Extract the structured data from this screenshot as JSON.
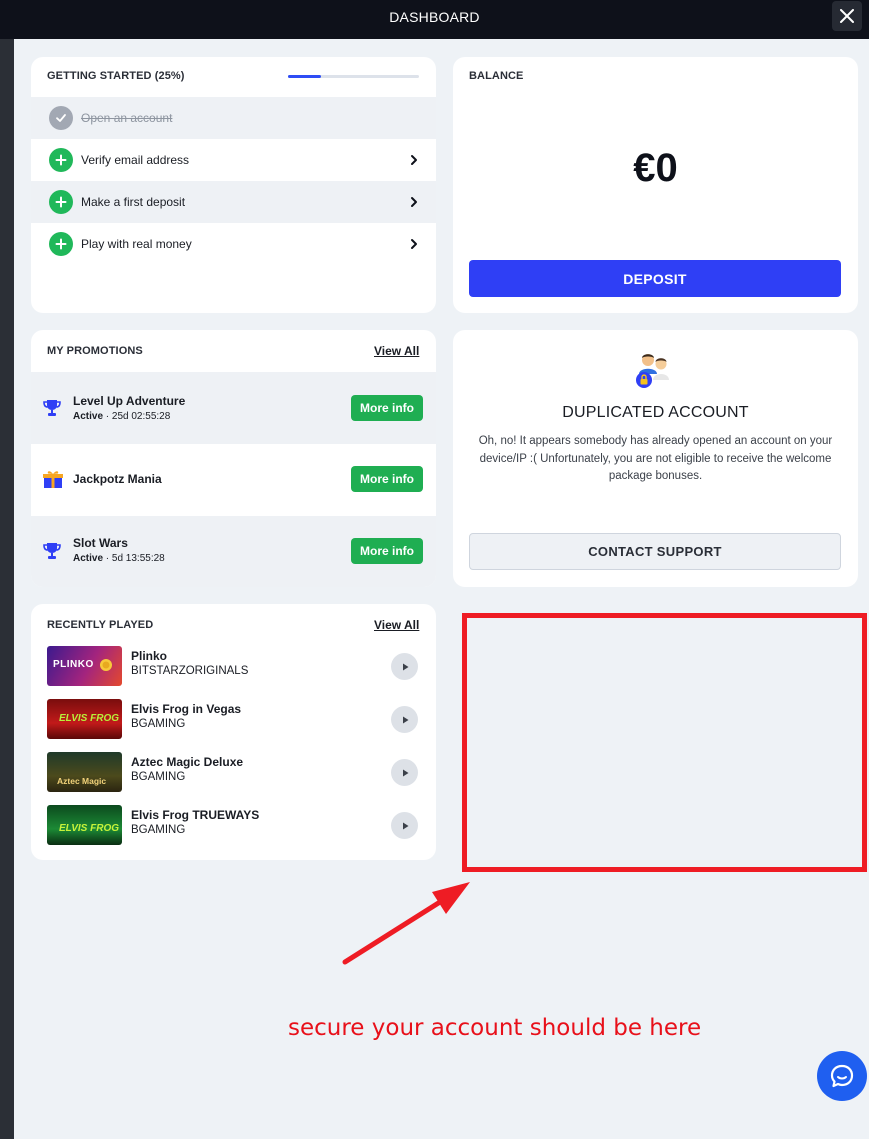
{
  "topbar": {
    "title": "DASHBOARD",
    "close_icon": "close-icon"
  },
  "getting_started": {
    "title": "GETTING STARTED (25%)",
    "progress_percent": 25,
    "steps": [
      {
        "label": "Open an account",
        "done": true,
        "icon": "check-icon"
      },
      {
        "label": "Verify email address",
        "done": false,
        "icon": "plus-icon"
      },
      {
        "label": "Make a first deposit",
        "done": false,
        "icon": "plus-icon"
      },
      {
        "label": "Play with real money",
        "done": false,
        "icon": "plus-icon"
      }
    ]
  },
  "balance": {
    "title": "BALANCE",
    "amount": "€0",
    "deposit_label": "DEPOSIT",
    "accent": "#2f3ff5"
  },
  "promotions": {
    "title": "MY PROMOTIONS",
    "view_all": "View All",
    "items": [
      {
        "title": "Level Up Adventure",
        "status": "Active",
        "timer": " · 25d 02:55:28",
        "icon": "trophy-icon",
        "button": "More info"
      },
      {
        "title": "Jackpotz Mania",
        "status": "",
        "timer": "",
        "icon": "gift-icon",
        "button": "More info"
      },
      {
        "title": "Slot Wars",
        "status": "Active",
        "timer": " · 5d 13:55:28",
        "icon": "trophy-icon",
        "button": "More info"
      }
    ]
  },
  "duplicated": {
    "title": "DUPLICATED ACCOUNT",
    "text": "Oh, no! It appears somebody has already opened an account on your device/IP :( Unfortunately, you are not eligible to receive the welcome package bonuses.",
    "button": "CONTACT SUPPORT",
    "icon": "users-lock-icon"
  },
  "recently_played": {
    "title": "RECENTLY PLAYED",
    "view_all": "View All",
    "games": [
      {
        "name": "Plinko",
        "provider": "BITSTARZORIGINALS",
        "thumb_text": "PLINKO"
      },
      {
        "name": "Elvis Frog in Vegas",
        "provider": "BGAMING",
        "thumb_text": "ELVIS FROG"
      },
      {
        "name": "Aztec Magic Deluxe",
        "provider": "BGAMING",
        "thumb_text": "Aztec Magic"
      },
      {
        "name": "Elvis Frog TRUEWAYS",
        "provider": "BGAMING",
        "thumb_text": "ELVIS FROG"
      }
    ]
  },
  "annotation": {
    "text": "secure your account should be here",
    "color": "#ee1c24"
  },
  "chat": {
    "icon": "chat-icon"
  }
}
